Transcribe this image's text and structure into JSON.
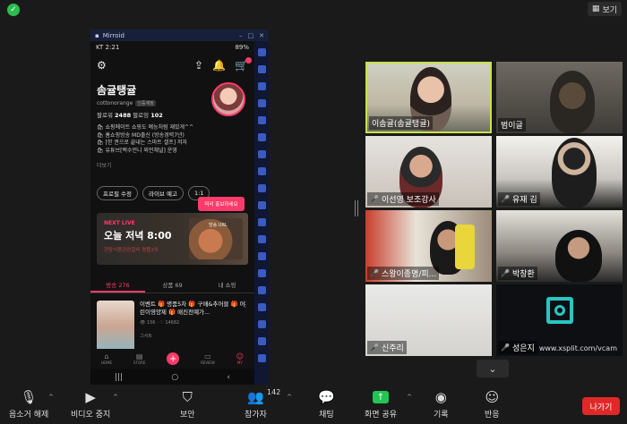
{
  "top": {
    "view_label": "보기"
  },
  "mirroid": {
    "title": "Mirroid"
  },
  "phone": {
    "status_time": "KT 2:21",
    "status_right": "89%",
    "profile": {
      "name": "솜귤탱귤",
      "handle": "cottonorange",
      "handle_tag": "인증계정",
      "followers_label": "팔로워",
      "followers": "2488",
      "following_label": "팔로잉",
      "following": "102",
      "bio": [
        "🛍 쇼핑메이트 쇼핑도 예능처럼 재밌게^^",
        "🛍 홈쇼핑방송 MD출신 (방송경력7년)",
        "🛍 [한 권으로 끝내는 스마트 셀프] 저자",
        "🛍 유튜브[백수언니 외언채널] 운영"
      ],
      "more": "더보기"
    },
    "buttons": [
      "프로필 수정",
      "라이브 예고",
      "1:1"
    ],
    "promo_tip": "미리 홍보하세요",
    "live": {
      "tag": "NEXT LIVE",
      "time": "오늘 저녁 8:00",
      "sub": "현장식품관광갈비 명품2차",
      "img_label": "방송 URL"
    },
    "tabs": [
      "방송 276",
      "상품 69",
      "내 쇼핑"
    ],
    "post": {
      "text": "이벤트 🎁 명품5차 🎁 구매&추어블 🎁 어린이영양제 🎁 매진전예가...",
      "meta": "👁 156 · ♡ 14682",
      "category": "그서트"
    },
    "bottom_nav": [
      "HOME",
      "STORE",
      "+",
      "REVIEW",
      "MY"
    ]
  },
  "participants": [
    {
      "name": "이솜귤(솜귤탱귤)",
      "muted": false
    },
    {
      "name": "범이글",
      "muted": false
    },
    {
      "name": "이선영 보조강사",
      "muted": true
    },
    {
      "name": "유재 김",
      "muted": true
    },
    {
      "name": "스왕이종명/피...",
      "muted": true
    },
    {
      "name": "박창환",
      "muted": true
    },
    {
      "name": "신주리",
      "muted": true
    },
    {
      "name": "성은지",
      "muted": true
    }
  ],
  "vcam_url": "www.xsplit.com/vcam",
  "toolbar": {
    "unmute": "음소거 해제",
    "stop_video": "비디오 중지",
    "security": "보안",
    "participants": "참가자",
    "participants_count": "142",
    "chat": "채팅",
    "share": "화면 공유",
    "record": "기록",
    "reactions": "반응",
    "leave": "나가기"
  }
}
